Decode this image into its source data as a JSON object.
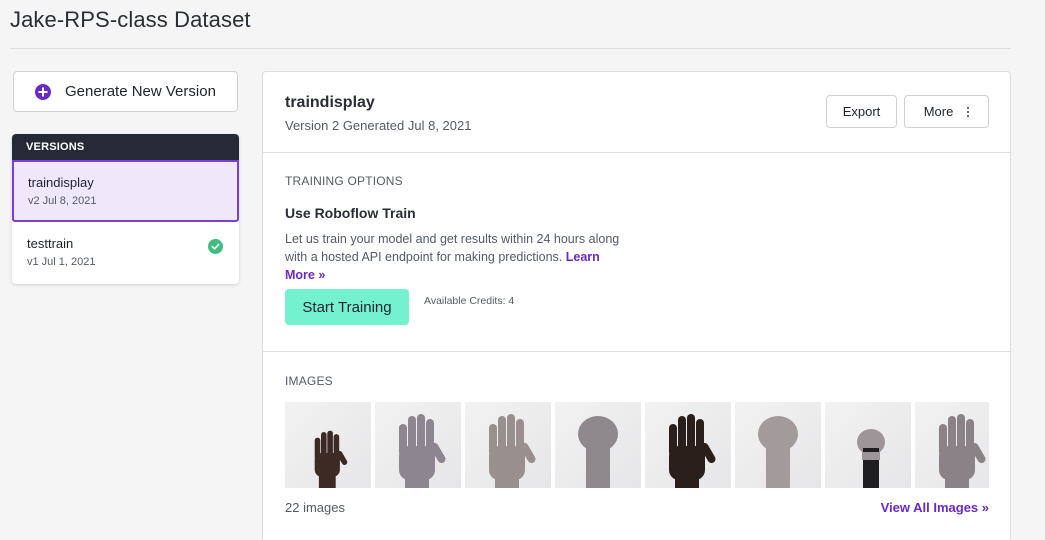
{
  "page": {
    "title": "Jake-RPS-class Dataset"
  },
  "sidebar": {
    "generate_label": "Generate New Version",
    "versions_header": "VERSIONS",
    "versions": [
      {
        "name": "traindisplay",
        "meta": "v2 Jul 8, 2021",
        "active": true
      },
      {
        "name": "testtrain",
        "meta": "v1 Jul 1, 2021",
        "status": "check"
      }
    ]
  },
  "main": {
    "title": "traindisplay",
    "subtitle": "Version 2 Generated Jul 8, 2021",
    "export_label": "Export",
    "more_label": "More",
    "training": {
      "section_label": "TRAINING OPTIONS",
      "title": "Use Roboflow Train",
      "description": "Let us train your model and get results within 24 hours along with a hosted API endpoint for making predictions.",
      "learn_more": "Learn More »",
      "start_label": "Start Training",
      "credits": "Available Credits: 4"
    },
    "images": {
      "section_label": "IMAGES",
      "count": "22 images",
      "view_all": "View All Images »",
      "thumbnails": [
        {
          "icon": "hand-photo",
          "skin": "#3d2a24",
          "pose": "paper-small"
        },
        {
          "icon": "hand-photo",
          "skin": "#8d8590",
          "pose": "paper"
        },
        {
          "icon": "hand-photo",
          "skin": "#9a8f8f",
          "pose": "paper"
        },
        {
          "icon": "hand-photo",
          "skin": "#8f888c",
          "pose": "rock"
        },
        {
          "icon": "hand-photo",
          "skin": "#2b1f1c",
          "pose": "paper"
        },
        {
          "icon": "hand-photo",
          "skin": "#a39a9c",
          "pose": "rock"
        },
        {
          "icon": "hand-photo",
          "skin": "#9d9597",
          "pose": "rock-small"
        },
        {
          "icon": "hand-photo",
          "skin": "#8a8286",
          "pose": "paper"
        }
      ]
    }
  },
  "colors": {
    "accent": "#6a29c9",
    "train_button": "#74f2cf",
    "versions_header": "#262a36",
    "active_bg": "#efe8fb",
    "success": "#3fbf7f"
  }
}
